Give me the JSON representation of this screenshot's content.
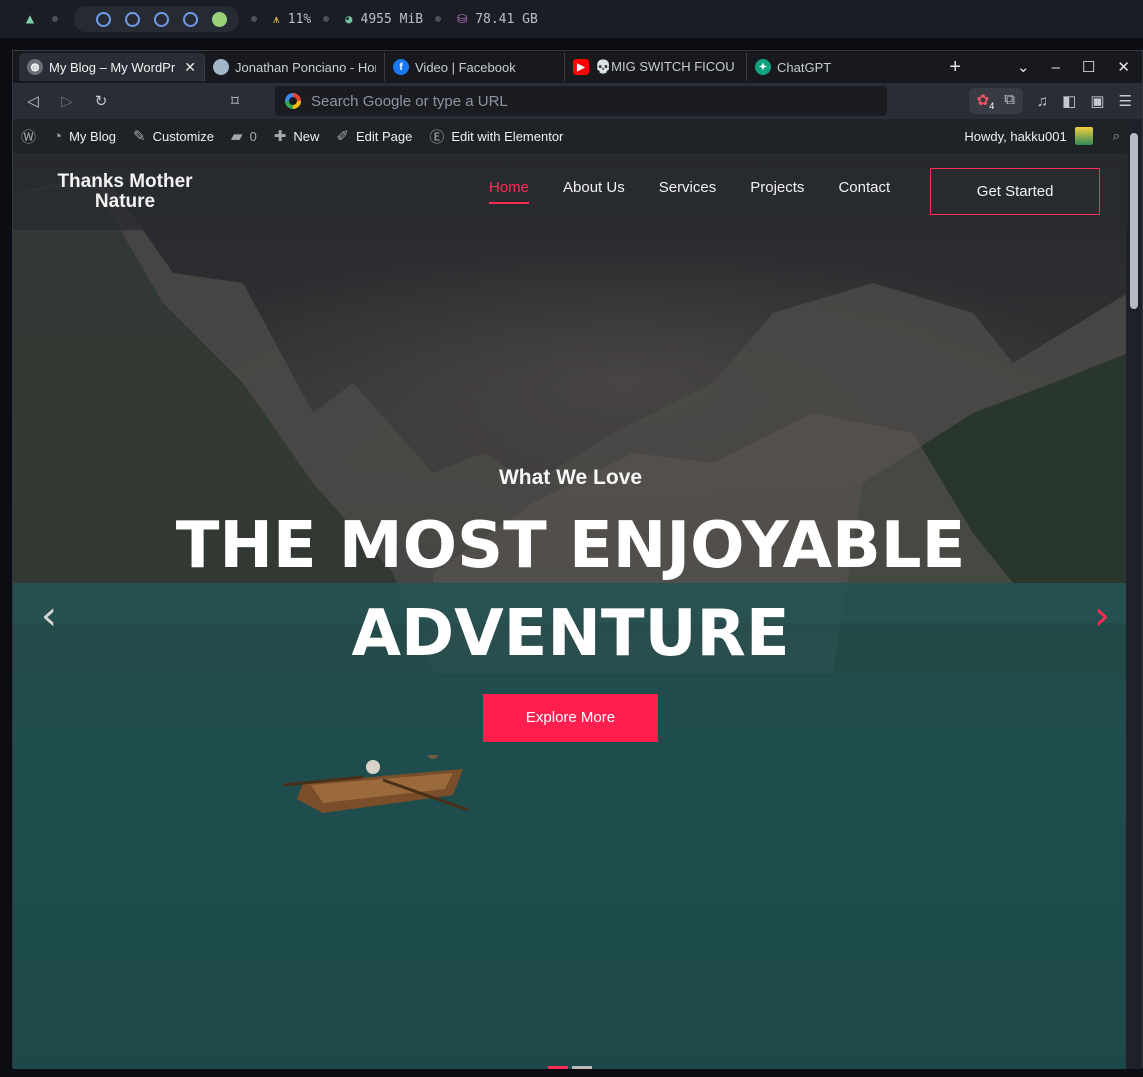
{
  "system_bar": {
    "cpu": "11%",
    "memory": "4955 MiB",
    "disk": "78.41 GB",
    "workspaces": [
      "1",
      "2",
      "3",
      "4",
      "5"
    ],
    "active_workspace_index": 4
  },
  "tabs": [
    {
      "title": "My Blog – My WordPr",
      "icon": "globe-icon",
      "active": true
    },
    {
      "title": "Jonathan Ponciano - Home",
      "icon": "avatar-icon"
    },
    {
      "title": "Video | Facebook",
      "icon": "facebook-icon"
    },
    {
      "title": "💀MIG SWITCH FICOU IN",
      "icon": "youtube-icon"
    },
    {
      "title": "ChatGPT",
      "icon": "chatgpt-icon"
    }
  ],
  "url_placeholder": "Search Google or type a URL",
  "extension_badge": "4",
  "admin_bar": {
    "site": "My Blog",
    "customize": "Customize",
    "comments": "0",
    "new": "New",
    "edit_page": "Edit Page",
    "elementor": "Edit with Elementor",
    "howdy": "Howdy, hakku001"
  },
  "site": {
    "title_line1": "Thanks Mother",
    "title_line2": "Nature",
    "nav": [
      "Home",
      "About Us",
      "Services",
      "Projects",
      "Contact"
    ],
    "cta": "Get Started"
  },
  "hero": {
    "kicker": "What We Love",
    "headline_line1": "THE MOST ENJOYABLE",
    "headline_line2": "ADVENTURE",
    "button": "Explore More"
  },
  "colors": {
    "accent": "#ff2d55",
    "admin_bar": "#1d2327"
  }
}
